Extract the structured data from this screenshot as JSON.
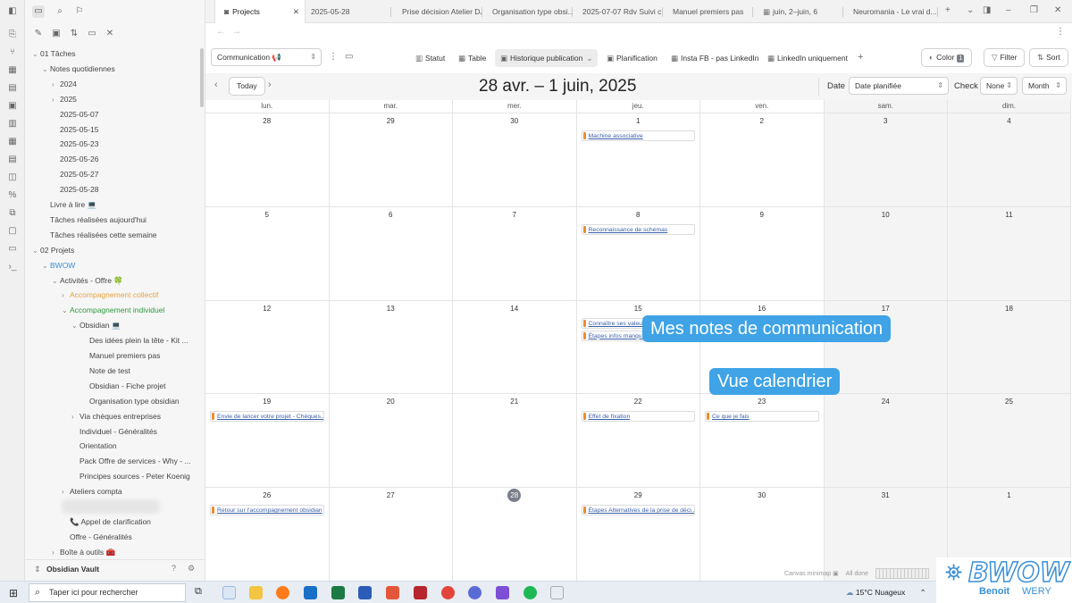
{
  "tabs": [
    {
      "label": "Projects",
      "active": true
    },
    {
      "label": "2025-05-28"
    },
    {
      "label": "Prise décision Atelier DJ"
    },
    {
      "label": "Organisation type obsi..."
    },
    {
      "label": "2025-07-07 Rdv Suivi c..."
    },
    {
      "label": "Manuel premiers pas"
    },
    {
      "label": "juin, 2–juin, 6"
    },
    {
      "label": "Neuromania - Le vrai d..."
    }
  ],
  "tree": [
    {
      "label": "01 Tâches",
      "level": 0,
      "chev": "⌄"
    },
    {
      "label": "Notes quotidiennes",
      "level": 1,
      "chev": "⌄"
    },
    {
      "label": "2024",
      "level": 2,
      "chev": "›"
    },
    {
      "label": "2025",
      "level": 2,
      "chev": "›"
    },
    {
      "label": "2025-05-07",
      "level": 2
    },
    {
      "label": "2025-05-15",
      "level": 2
    },
    {
      "label": "2025-05-23",
      "level": 2
    },
    {
      "label": "2025-05-26",
      "level": 2
    },
    {
      "label": "2025-05-27",
      "level": 2
    },
    {
      "label": "2025-05-28",
      "level": 2
    },
    {
      "label": "Livre à lire 💻",
      "level": 1
    },
    {
      "label": "Tâches réalisées aujourd'hui",
      "level": 1
    },
    {
      "label": "Tâches réalisées cette semaine",
      "level": 1
    },
    {
      "label": "02 Projets",
      "level": 0,
      "chev": "⌄"
    },
    {
      "label": "BWOW",
      "level": 1,
      "chev": "⌄",
      "color": "#3a8fd6"
    },
    {
      "label": "Activités - Offre 🍀",
      "level": 2,
      "chev": "⌄"
    },
    {
      "label": "Accompagnement collectif",
      "level": 3,
      "chev": "›",
      "color": "#e8a23a"
    },
    {
      "label": "Accompagnement individuel",
      "level": 3,
      "chev": "⌄",
      "color": "#2e9a3e"
    },
    {
      "label": "Obsidian 💻",
      "level": 4,
      "chev": "⌄"
    },
    {
      "label": "Des idées plein la tête - Kit ...",
      "level": 5
    },
    {
      "label": "Manuel premiers pas",
      "level": 5
    },
    {
      "label": "Note de test",
      "level": 5
    },
    {
      "label": "Obsidian - Fiche projet",
      "level": 5
    },
    {
      "label": "Organisation type obsidian",
      "level": 5
    },
    {
      "label": "Via chèques entreprises",
      "level": 4,
      "chev": "›"
    },
    {
      "label": "Individuel - Généralités",
      "level": 4
    },
    {
      "label": "Orientation",
      "level": 4
    },
    {
      "label": "Pack Offre de services - Why - ...",
      "level": 4
    },
    {
      "label": "Principes sources - Peter Koenig",
      "level": 4
    },
    {
      "label": "Ateliers compta",
      "level": 3,
      "chev": "›"
    },
    {
      "label": "",
      "level": 3,
      "blur": true
    },
    {
      "label": "📞 Appel de clarification",
      "level": 3
    },
    {
      "label": "Offre - Généralités",
      "level": 3
    },
    {
      "label": "Boîte à outils 🧰",
      "level": 2,
      "chev": "›"
    }
  ],
  "vault_name": "Obsidian Vault",
  "toolbar": {
    "source": "Communication 📢",
    "views": [
      "Statut",
      "Table",
      "Historique publication",
      "Planification",
      "Insta FB - pas LinkedIn",
      "LinkedIn uniquement"
    ],
    "active_view": "Historique publication",
    "color_label": "Color",
    "color_count": "1",
    "filter_label": "Filter",
    "sort_label": "Sort"
  },
  "calendar": {
    "today_label": "Today",
    "title": "28 avr. – 1 juin, 2025",
    "date_label": "Date",
    "date_field": "Date planifiée",
    "check_label": "Check",
    "check_value": "None",
    "view_mode": "Month",
    "weekdays": [
      "lun.",
      "mar.",
      "mer.",
      "jeu.",
      "ven.",
      "sam.",
      "dim."
    ],
    "weeks": [
      [
        "28",
        "29",
        "30",
        "1",
        "2",
        "3",
        "4"
      ],
      [
        "5",
        "6",
        "7",
        "8",
        "9",
        "10",
        "11"
      ],
      [
        "12",
        "13",
        "14",
        "15",
        "16",
        "17",
        "18"
      ],
      [
        "19",
        "20",
        "21",
        "22",
        "23",
        "24",
        "25"
      ],
      [
        "26",
        "27",
        "28",
        "29",
        "30",
        "31",
        "1"
      ]
    ],
    "today": {
      "week": 4,
      "day": 2
    },
    "events": [
      {
        "week": 0,
        "day": 3,
        "slot": 0,
        "label": "Machine associative"
      },
      {
        "week": 1,
        "day": 3,
        "slot": 0,
        "label": "Reconnaissance de schémas"
      },
      {
        "week": 2,
        "day": 3,
        "slot": 0,
        "label": "Connaître ses valeurs"
      },
      {
        "week": 2,
        "day": 3,
        "slot": 1,
        "label": "Étapes infos manquantes"
      },
      {
        "week": 3,
        "day": 0,
        "slot": 0,
        "label": "Envie de lancer votre projet - Chèques..."
      },
      {
        "week": 3,
        "day": 3,
        "slot": 0,
        "label": "Effet de fixation"
      },
      {
        "week": 3,
        "day": 4,
        "slot": 0,
        "label": "Ce que je fais"
      },
      {
        "week": 4,
        "day": 0,
        "slot": 0,
        "label": "Retour sur l'accompagnement obsidian"
      },
      {
        "week": 4,
        "day": 3,
        "slot": 0,
        "label": "Étapes Alternatives de la prise de déci..."
      }
    ]
  },
  "callouts": {
    "main": "Mes notes de communication",
    "sub": "Vue calendrier"
  },
  "minimap": {
    "label": "Canvas minimap",
    "status": "All done"
  },
  "taskbar": {
    "search_placeholder": "Taper ici pour rechercher",
    "weather": "15°C  Nuageux"
  },
  "logo": {
    "brand": "BWOW",
    "first": "Benoit",
    "last": "WERY"
  }
}
